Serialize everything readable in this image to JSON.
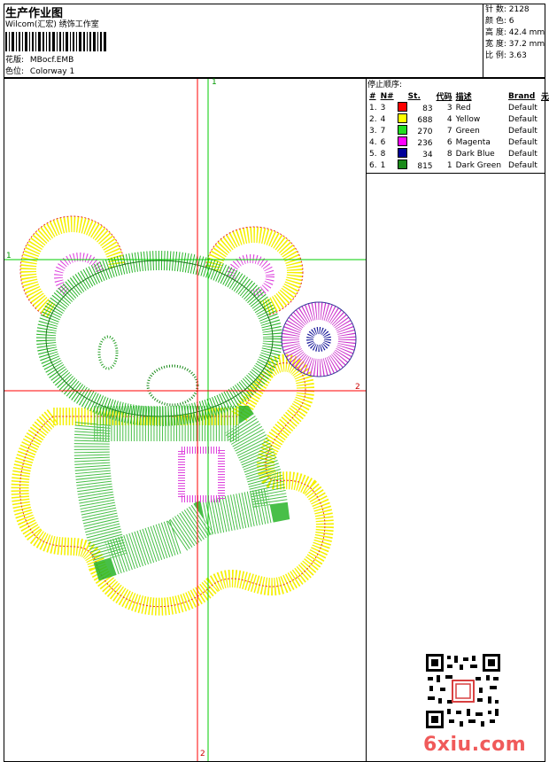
{
  "header": {
    "title": "生产作业图",
    "company": "Wilcom(汇宏) 绣饰工作室",
    "design_label": "花版:",
    "design_value": "MBocf.EMB",
    "colorway_label": "色位:",
    "colorway_value": "Colorway 1"
  },
  "stats": {
    "stitches": "针 数: 2128",
    "colors": "颜 色: 6",
    "height": "高 度: 42.4 mm",
    "width": "宽 度: 37.2 mm",
    "scale": "比 例: 3.63"
  },
  "sequence": {
    "title": "停止顺序:",
    "headers": {
      "num": "#",
      "n": "N#",
      "st": "St.",
      "code": "代码",
      "desc": "描述",
      "brand": "Brand",
      "elem": "元素"
    },
    "rows": [
      {
        "idx": "1.",
        "n": "3",
        "color": "#ff0000",
        "st": "83",
        "code": "3",
        "desc": "Red",
        "brand": "Default"
      },
      {
        "idx": "2.",
        "n": "4",
        "color": "#ffff00",
        "st": "688",
        "code": "4",
        "desc": "Yellow",
        "brand": "Default"
      },
      {
        "idx": "3.",
        "n": "7",
        "color": "#22dd22",
        "st": "270",
        "code": "7",
        "desc": "Green",
        "brand": "Default"
      },
      {
        "idx": "4.",
        "n": "6",
        "color": "#ff00ff",
        "st": "236",
        "code": "6",
        "desc": "Magenta",
        "brand": "Default"
      },
      {
        "idx": "5.",
        "n": "8",
        "color": "#000099",
        "st": "34",
        "code": "8",
        "desc": "Dark Blue",
        "brand": "Default"
      },
      {
        "idx": "6.",
        "n": "1",
        "color": "#1a8a1a",
        "st": "815",
        "code": "1",
        "desc": "Dark Green",
        "brand": "Default"
      }
    ]
  },
  "axes": {
    "h1": "1",
    "h2": "2",
    "v1": "1",
    "v2": "2"
  },
  "watermark": "6xiu.com"
}
